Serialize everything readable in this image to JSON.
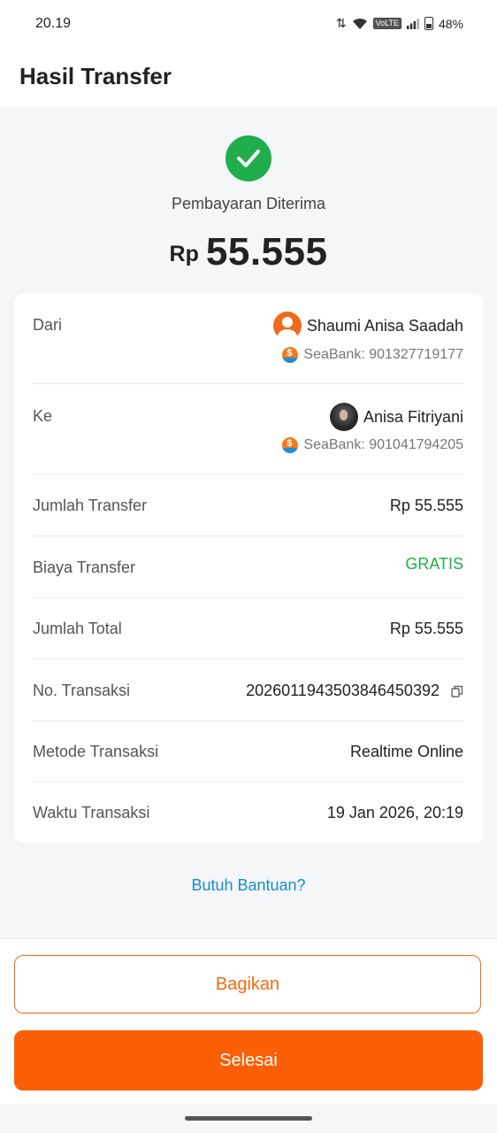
{
  "status_bar": {
    "time": "20.19",
    "volte": "VoLTE",
    "battery": "48%"
  },
  "header": {
    "title": "Hasil Transfer"
  },
  "hero": {
    "status": "Pembayaran Diterima",
    "currency": "Rp",
    "amount": "55.555",
    "success_color": "#1fae4b"
  },
  "details": {
    "from_label": "Dari",
    "from_name": "Shaumi Anisa Saadah",
    "from_bank": "SeaBank: 901327719177",
    "to_label": "Ke",
    "to_name": "Anisa Fitriyani",
    "to_bank": "SeaBank: 901041794205",
    "rows": [
      {
        "label": "Jumlah Transfer",
        "value": "Rp 55.555"
      },
      {
        "label": "Biaya Transfer",
        "value": "GRATIS"
      },
      {
        "label": "Jumlah Total",
        "value": "Rp 55.555"
      },
      {
        "label": "No. Transaksi",
        "value": "20260119435038464503​92"
      },
      {
        "label": "Metode Transaksi",
        "value": "Realtime Online"
      },
      {
        "label": "Waktu Transaksi",
        "value": "19 Jan 2026, 20:19"
      }
    ]
  },
  "help": {
    "link": "Butuh Bantuan?"
  },
  "actions": {
    "share_label": "Bagikan",
    "done_label": "Selesai",
    "accent_color": "#fa5f06"
  },
  "icons": {
    "check": "check-icon",
    "copy": "copy-icon",
    "bank": "seabank-icon"
  }
}
